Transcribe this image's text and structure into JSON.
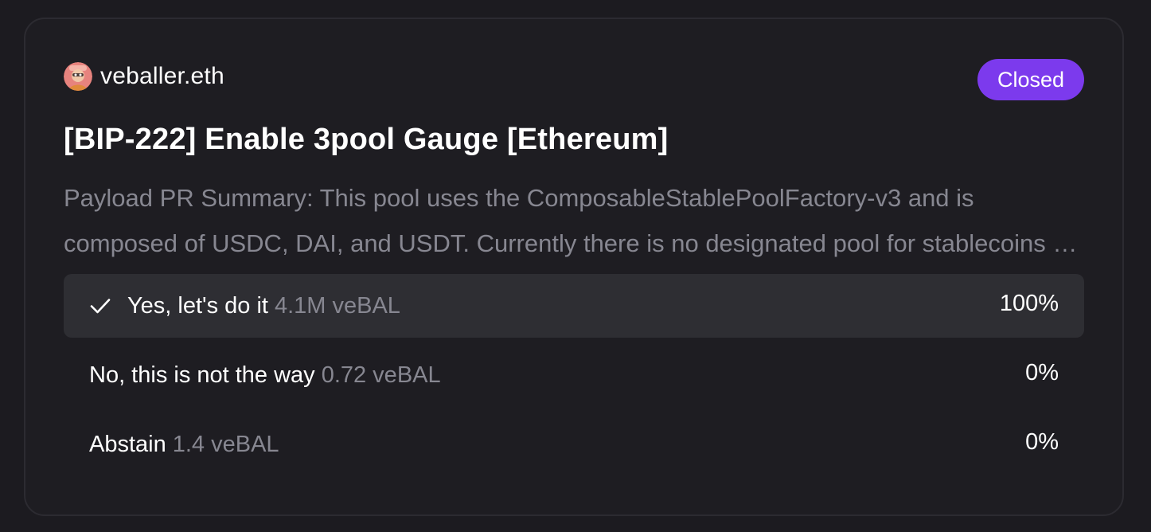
{
  "proposal": {
    "author": "veballer.eth",
    "status": "Closed",
    "title": "[BIP-222] Enable 3pool Gauge [Ethereum]",
    "summary": "Payload PR Summary: This pool uses the ComposableStablePoolFactory-v3 and is composed of USDC, DAI, and USDT. Currently there is no designated pool for stablecoins on Ethereum mainnet and this pool will provide a core liquidity hub."
  },
  "choices": [
    {
      "label": "Yes, let's do it",
      "votes": "4.1M veBAL",
      "percent": "100%",
      "winner": true,
      "icon": "check-icon"
    },
    {
      "label": "No, this is not the way",
      "votes": "0.72 veBAL",
      "percent": "0%",
      "winner": false
    },
    {
      "label": "Abstain",
      "votes": "1.4 veBAL",
      "percent": "0%",
      "winner": false
    }
  ],
  "colors": {
    "background": "#1c1b20",
    "card": "#1e1d22",
    "accent": "#7c3aed",
    "muted_text": "#878791",
    "winner_row": "#2e2e33"
  }
}
